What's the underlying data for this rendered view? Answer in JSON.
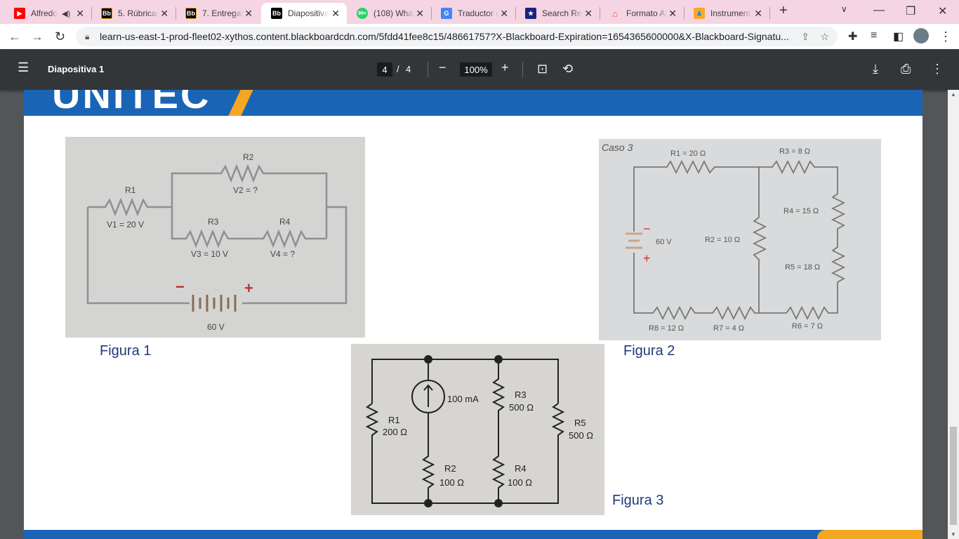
{
  "browser": {
    "tabs": [
      {
        "title": "Alfredo",
        "icon": "youtube-icon",
        "color": "#ff0000",
        "audio": true
      },
      {
        "title": "5. Rúbricas",
        "icon": "blackboard-icon",
        "color": "#000000"
      },
      {
        "title": "7. Entregable",
        "icon": "blackboard-icon",
        "color": "#000000"
      },
      {
        "title": "Diapositiva 1",
        "icon": "blackboard-icon",
        "color": "#000000",
        "active": true
      },
      {
        "title": "(108) WhatsApp",
        "icon": "whatsapp-icon",
        "color": "#25d366",
        "badge": "99+"
      },
      {
        "title": "Traductor de Google",
        "icon": "google-translate-icon",
        "color": "#4285f4"
      },
      {
        "title": "Search Results",
        "icon": "shield-star-icon",
        "color": "#1a237e"
      },
      {
        "title": "Formato APA",
        "icon": "graduation-cap-icon",
        "color": "#f4511e"
      },
      {
        "title": "Instrumento",
        "icon": "app-icon",
        "color": "#f9a825"
      }
    ],
    "url": "learn-us-east-1-prod-fleet02-xythos.content.blackboardcdn.com/5fdd41fee8c15/48661757?X-Blackboard-Expiration=1654365600000&X-Blackboard-Signatu..."
  },
  "pdf": {
    "title": "Diapositiva 1",
    "page": "4",
    "total": "4",
    "zoom": "100%"
  },
  "slide": {
    "logo": "UNITEC",
    "fig1": {
      "caption": "Figura 1",
      "r1": "R1",
      "r2": "R2",
      "r3": "R3",
      "r4": "R4",
      "v1": "V1 = 20 V",
      "v2": "V2 = ?",
      "v3": "V3 = 10 V",
      "v4": "V4 = ?",
      "battery": "60 V",
      "minus": "−",
      "plus": "+"
    },
    "fig2": {
      "caption": "Figura 2",
      "case": "Caso 3",
      "r1": "R1 = 20 Ω",
      "r2": "R2 = 10 Ω",
      "r3": "R3 = 8 Ω",
      "r4": "R4 = 15 Ω",
      "r5": "R5 = 18 Ω",
      "r6": "R6 = 7 Ω",
      "r7": "R7 = 4 Ω",
      "r8": "R8 = 12 Ω",
      "battery": "60 V",
      "minus": "−",
      "plus": "+"
    },
    "fig3": {
      "caption": "Figura 3",
      "source": "100 mA",
      "r1": "R1",
      "r1v": "200 Ω",
      "r2": "R2",
      "r2v": "100 Ω",
      "r3": "R3",
      "r3v": "500 Ω",
      "r4": "R4",
      "r4v": "100 Ω",
      "r5": "R5",
      "r5v": "500 Ω"
    }
  }
}
